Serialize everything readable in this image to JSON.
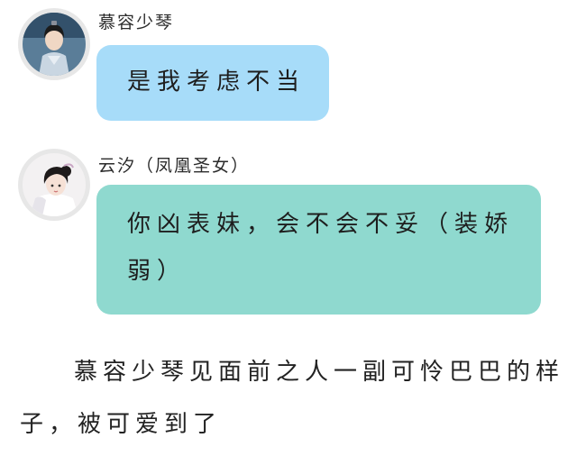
{
  "messages": [
    {
      "sender": "慕容少琴",
      "avatar_icon": "male-character-avatar",
      "bubble_color": "#a7dcf9",
      "text": "是我考虑不当"
    },
    {
      "sender": "云汐（凤凰圣女）",
      "avatar_icon": "female-character-avatar",
      "bubble_color": "#8fd9cf",
      "text": "你凶表妹，会不会不妥（装娇弱）"
    }
  ],
  "narration": {
    "text": "慕容少琴见面前之人一副可怜巴巴的样子，被可爱到了"
  }
}
